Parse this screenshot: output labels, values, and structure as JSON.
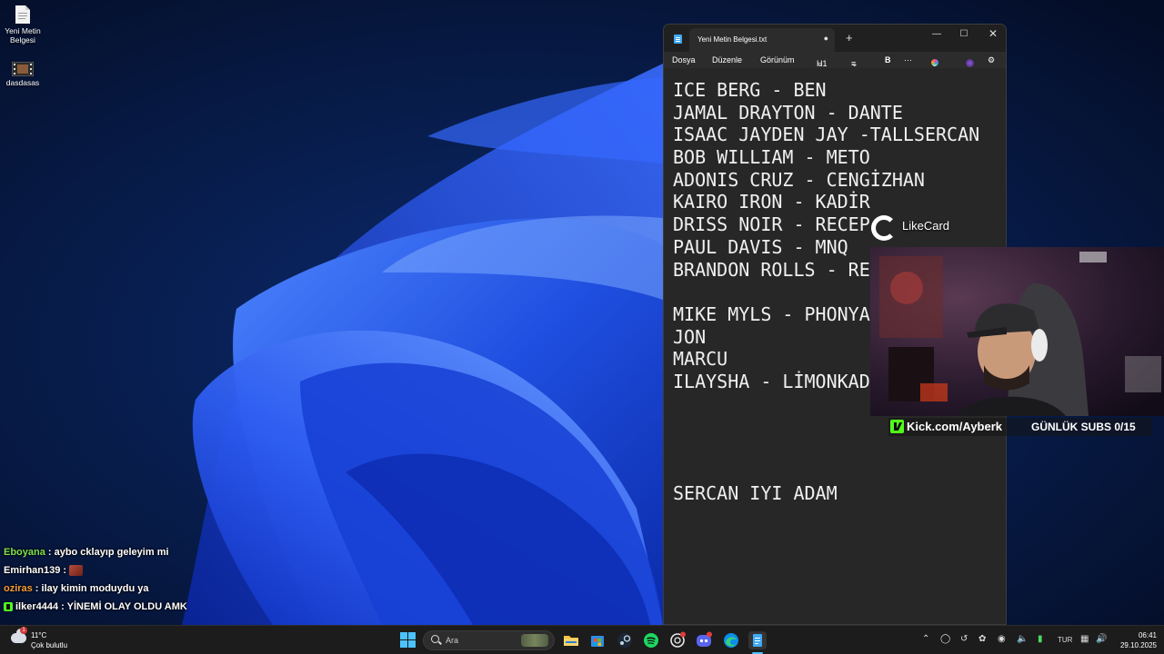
{
  "desktop": {
    "icons": [
      {
        "label_line1": "Yeni Metin",
        "label_line2": "Belgesi",
        "icon": "text-file-icon"
      },
      {
        "label": "dasdasas",
        "icon": "video-file-icon"
      }
    ]
  },
  "chat": {
    "messages": [
      {
        "user": "Eboyana",
        "user_color": "#7ee04e",
        "text": ": aybo cklayıp geleyim mi"
      },
      {
        "user": "Emirhan139",
        "user_color": "#ffffff",
        "text": ":"
      },
      {
        "user": "oziras",
        "user_color": "#f39c3a",
        "text": ": ilay kimin moduydu ya"
      },
      {
        "user": "ilker4444",
        "user_color": "#ffffff",
        "text": ": YİNEMİ OLAY OLDU AMK"
      }
    ]
  },
  "notepad": {
    "tab_title": "Yeni Metin Belgesi.txt",
    "tab_unsaved_marker": "●",
    "new_tab": "+",
    "menu": {
      "file": "Dosya",
      "edit": "Düzenle",
      "view": "Görünüm",
      "heading": "H1",
      "bold": "B",
      "more": "···"
    },
    "lines": [
      "ICE BERG - BEN",
      "JAMAL DRAYTON - DANTE",
      "ISAAC JAYDEN JAY -TALLSERCAN",
      "BOB WILLIAM - METO",
      "ADONIS CRUZ - CENGİZHAN",
      "KAIRO IRON - KADİR",
      "DRISS NOIR - RECEP",
      "PAUL DAVIS - MNQ",
      "BRANDON ROLLS - RE",
      "",
      "MIKE MYLS - PHONYA",
      "JON",
      "MARCU",
      "ILAYSHA - LİMONKAD",
      "",
      "",
      "",
      "",
      "SERCAN IYI ADAM"
    ]
  },
  "overlay": {
    "sponsor": "LikeCard",
    "kick_url": "Kick.com/Ayberk",
    "subs_goal": "GÜNLÜK SUBS 0/15",
    "kick_color": "#53fc18"
  },
  "taskbar": {
    "weather_temp": "11°C",
    "weather_desc": "Çok bulutlu",
    "weather_badge": "1",
    "search_placeholder": "Ara",
    "language": "TUR",
    "time": "06:41",
    "date": "29.10.2025"
  }
}
